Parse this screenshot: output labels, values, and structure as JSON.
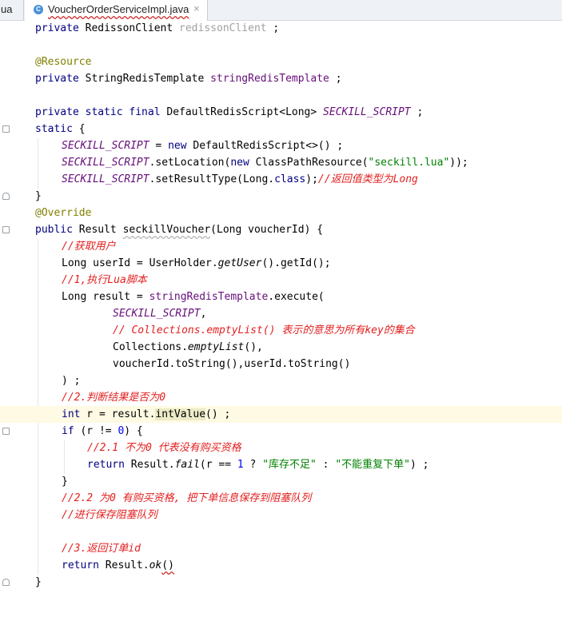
{
  "tabs": [
    {
      "label": "ua"
    },
    {
      "label": "VoucherOrderServiceImpl.java",
      "icon": "java-class-icon",
      "icon_glyph": "C",
      "close_glyph": "×"
    }
  ],
  "code": {
    "l1": {
      "a": "private",
      "b": " RedissonClient ",
      "c": "redissonClient",
      "d": " ;"
    },
    "l3": {
      "a": "@Resource"
    },
    "l4": {
      "a": "private",
      "b": " StringRedisTemplate ",
      "c": "stringRedisTemplate",
      "d": " ;"
    },
    "l6": {
      "a": "private static final",
      "b": " DefaultRedisScript<Long> ",
      "c": "SECKILL_SCRIPT",
      "d": " ;"
    },
    "l7": {
      "a": "static",
      "b": " {"
    },
    "l8": {
      "a": "SECKILL_SCRIPT",
      "b": " = ",
      "c": "new",
      "d": " DefaultRedisScript<>() ;"
    },
    "l9": {
      "a": "SECKILL_SCRIPT",
      "b": ".setLocation(",
      "c": "new",
      "d": " ClassPathResource(",
      "e": "\"seckill.lua\"",
      "f": "));"
    },
    "l10": {
      "a": "SECKILL_SCRIPT",
      "b": ".setResultType(Long.",
      "c": "class",
      "d": ");",
      "e": "//返回值类型为Long"
    },
    "l11": {
      "a": "}"
    },
    "l12": {
      "a": "@Override"
    },
    "l13": {
      "a": "public",
      "b": " Result ",
      "c": "seckillVoucher",
      "d": "(Long voucherId) {"
    },
    "l14": {
      "a": "//获取用户"
    },
    "l15": {
      "a": "Long userId = UserHolder.",
      "b": "getUser",
      "c": "().getId();"
    },
    "l16": {
      "a": "//1,执行Lua脚本"
    },
    "l17": {
      "a": "Long result = ",
      "b": "stringRedisTemplate",
      "c": ".execute("
    },
    "l18": {
      "a": "SECKILL_SCRIPT",
      "b": ","
    },
    "l19": {
      "a": "// Collections.emptyList() 表示的意思为所有key的集合"
    },
    "l20": {
      "a": "Collections.",
      "b": "emptyList",
      "c": "(),"
    },
    "l21": {
      "a": "voucherId.toString(),userId.toString()"
    },
    "l22": {
      "a": ") ;"
    },
    "l23": {
      "a": "//2.判断结果是否为0"
    },
    "l24": {
      "a": "int",
      "b": " r = result.",
      "c": "intValue",
      "d": "() ;"
    },
    "l25": {
      "a": "if",
      "b": " (r != ",
      "c": "0",
      "d": ") {"
    },
    "l26": {
      "a": "//2.1 不为0 代表没有购买资格"
    },
    "l27": {
      "a": "return",
      "b": " Result.",
      "c": "fail",
      "d": "(r == ",
      "e": "1",
      "f": " ? ",
      "g": "\"库存不足\"",
      "h": " : ",
      "i": "\"不能重复下单\"",
      "j": ") ;"
    },
    "l28": {
      "a": "}"
    },
    "l29": {
      "a": "//2.2 为0 有购买资格, 把下单信息保存到阻塞队列"
    },
    "l30": {
      "a": "//进行保存阻塞队列"
    },
    "l32": {
      "a": "//3.返回订单id"
    },
    "l33": {
      "a": "return",
      "b": " Result.",
      "c": "ok",
      "d": "()"
    },
    "l34": {
      "a": "}"
    }
  }
}
